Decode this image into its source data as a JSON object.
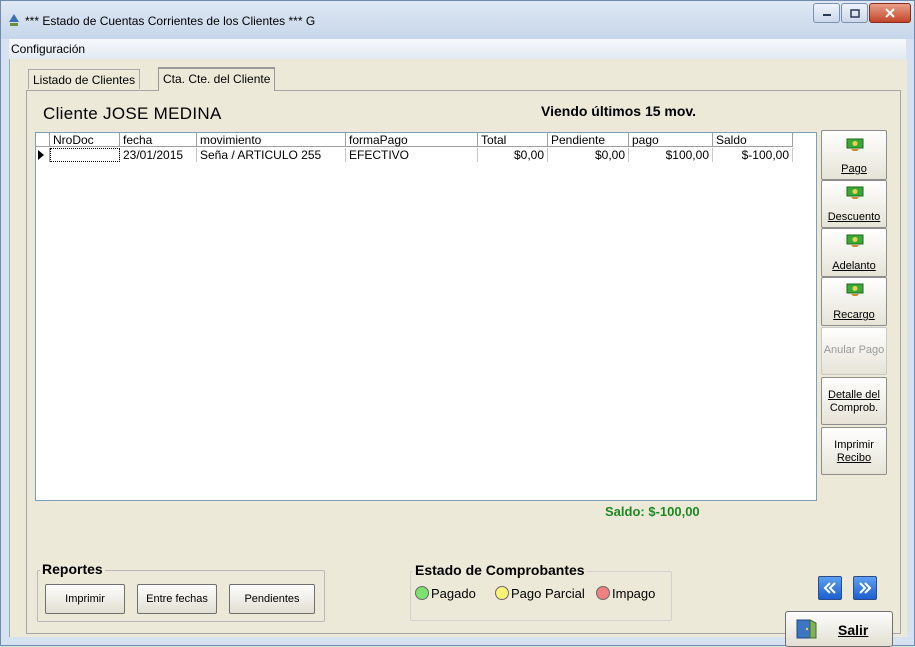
{
  "window": {
    "title": "*** Estado de Cuentas Corrientes de los Clientes *** G"
  },
  "menu": {
    "config": "Configuración"
  },
  "tabs": [
    {
      "label": "Listado de Clientes"
    },
    {
      "label": "Cta. Cte. del Cliente"
    }
  ],
  "header": {
    "cliente": "Cliente JOSE MEDINA",
    "viendo": "Viendo últimos 15 mov."
  },
  "grid": {
    "columns": [
      "NroDoc",
      "fecha",
      "movimiento",
      "formaPago",
      "Total",
      "Pendiente",
      "pago",
      "Saldo"
    ],
    "rows": [
      {
        "nrodoc": "",
        "fecha": "23/01/2015",
        "movimiento": "Seña / ARTICULO 255",
        "formapago": "EFECTIVO",
        "total": "$0,00",
        "pendiente": "$0,00",
        "pago": "$100,00",
        "saldo": "$-100,00"
      }
    ]
  },
  "side_buttons": {
    "pago": "Pago",
    "descuento": "Descuento",
    "adelanto": "Adelanto",
    "recargo": "Recargo",
    "anular": "Anular Pago",
    "detalle_1": "Detalle del",
    "detalle_2": "Comprob.",
    "imprimir_1": "Imprimir",
    "imprimir_2": "Recibo"
  },
  "saldo": "Saldo: $-100,00",
  "reportes": {
    "title": "Reportes",
    "imprimir": "Imprimir",
    "entre_fechas": "Entre fechas",
    "pendientes": "Pendientes"
  },
  "estado": {
    "title": "Estado de Comprobantes",
    "pagado": "Pagado",
    "pago_parcial": "Pago Parcial",
    "impago": "Impago"
  },
  "salir": "Salir",
  "colors": {
    "pagado": "#7ee06f",
    "pago_parcial": "#fff27a",
    "impago": "#f07f7f",
    "saldo": "#1c8a23"
  },
  "icons": [
    "money-icon",
    "prev-icon",
    "next-icon",
    "door-exit-icon"
  ]
}
